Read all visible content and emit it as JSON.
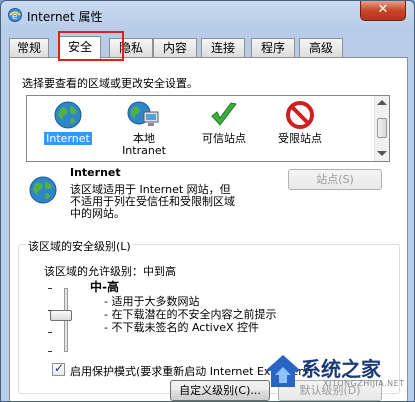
{
  "window": {
    "title": "Internet 属性",
    "close_glyph": "✕"
  },
  "tabs": [
    {
      "label": "常规"
    },
    {
      "label": "安全"
    },
    {
      "label": "隐私"
    },
    {
      "label": "内容"
    },
    {
      "label": "连接"
    },
    {
      "label": "程序"
    },
    {
      "label": "高级"
    }
  ],
  "active_tab": "安全",
  "security": {
    "select_zone_label": "选择要查看的区域或更改安全设置。",
    "zones": [
      {
        "label": "Internet",
        "icon": "globe-icon",
        "selected": true
      },
      {
        "label": "本地\nIntranet",
        "label_line1": "本地",
        "label_line2": "Intranet",
        "icon": "intranet-icon"
      },
      {
        "label": "可信站点",
        "icon": "checkmark-icon"
      },
      {
        "label": "受限站点",
        "icon": "restricted-icon"
      }
    ],
    "zone_title": "Internet",
    "zone_desc_line1": "该区域适用于 Internet 网站，但",
    "zone_desc_line2": "不适用于列在受信任和受限制区域",
    "zone_desc_line3": "中的网站。",
    "sites_button": "站点(S)",
    "group_title": "该区域的安全级别(L)",
    "allowed_levels": "该区域的允许级别：中到高",
    "level_name": "中-高",
    "level_bullets": [
      "- 适用于大多数网站",
      "- 在下载潜在的不安全内容之前提示",
      "- 不下载未签名的 ActiveX 控件"
    ],
    "protected_mode": {
      "label": "启用保护模式(要求重新启动 Internet Explorer)",
      "checked": true
    },
    "custom_level_button": "自定义级别(C)...",
    "default_level_button": "默认级别(D)",
    "slider_level": 0.5
  },
  "watermark": {
    "text": "系统之家",
    "url": "XITONGZHIJIA.NET"
  },
  "colors": {
    "selection": "#3399ff",
    "highlight_box": "#e0201a"
  }
}
